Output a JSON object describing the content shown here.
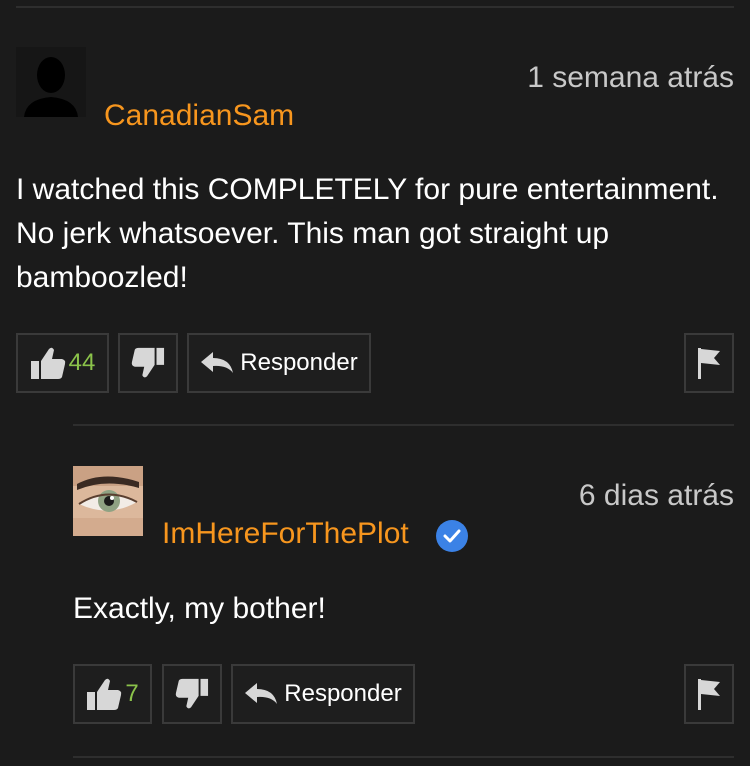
{
  "colors": {
    "background": "#1b1b1b",
    "username": "#f7961e",
    "like_count": "#8bc34a",
    "verified_badge": "#3b82e6"
  },
  "comments": [
    {
      "username": "CanadianSam",
      "timestamp": "1 semana atrás",
      "text": "I watched this COMPLETELY for pure entertainment. No jerk whatsoever. This man got straight up bamboozled!",
      "likes": "44",
      "reply_label": "Responder",
      "avatar_icon": "default-user-silhouette-icon"
    },
    {
      "username": "ImHereForThePlot",
      "verified": true,
      "timestamp": "6 dias atrás",
      "text": "Exactly, my bother!",
      "likes": "7",
      "reply_label": "Responder",
      "avatar_icon": "eye-photo-icon"
    }
  ]
}
